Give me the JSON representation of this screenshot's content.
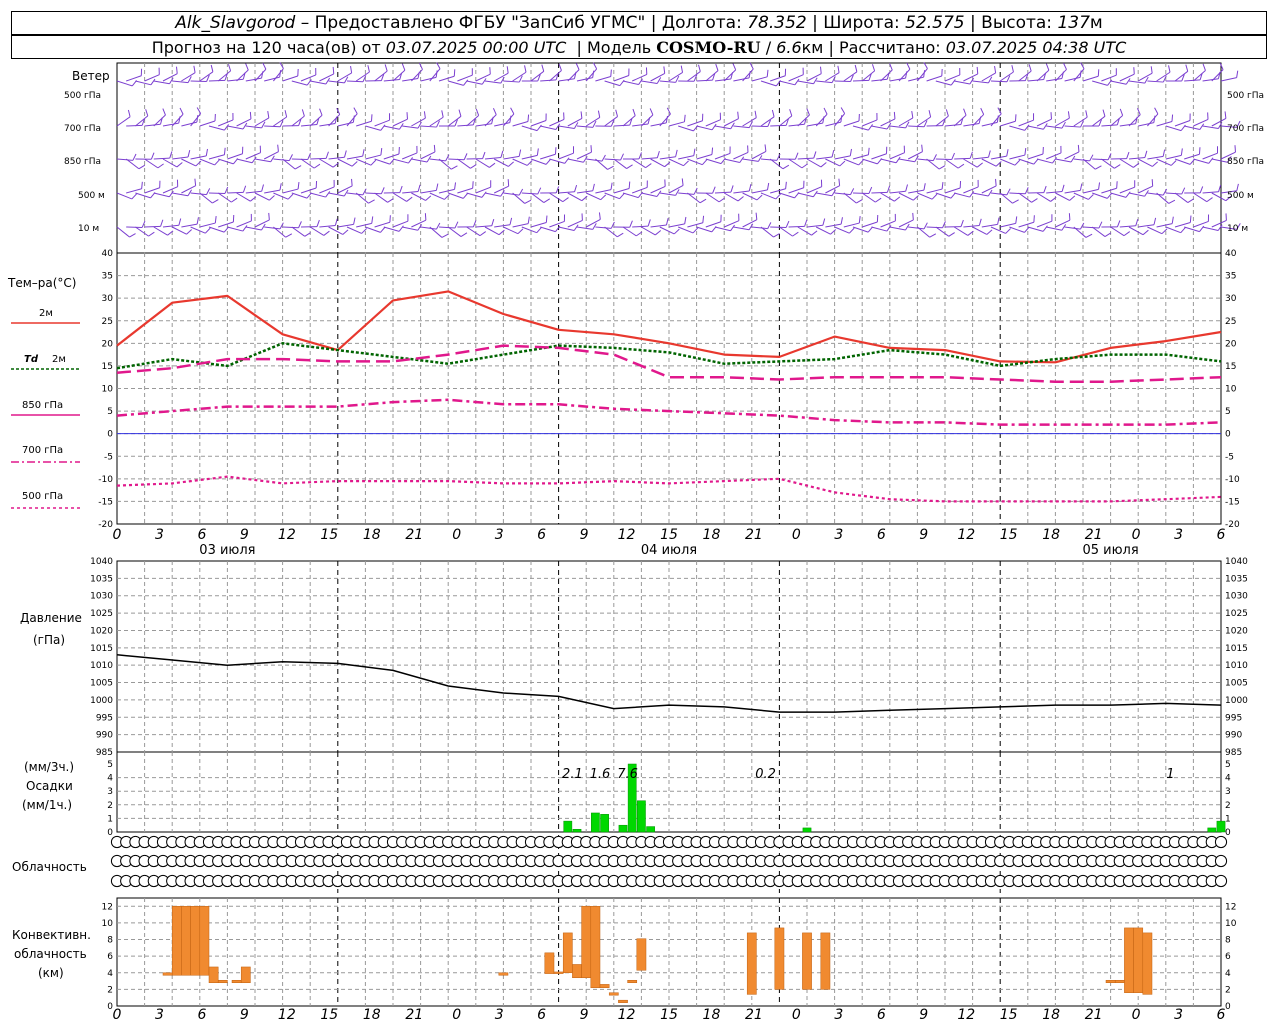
{
  "header": {
    "station": "Alk_Slavgorod",
    "dash": "–",
    "provider": "Предоставлено ФГБУ \"ЗапСиб УГМС\"",
    "sep": "|",
    "lon_label": "Долгота:",
    "lon": "78.352",
    "lat_label": "Широта:",
    "lat": "52.575",
    "alt_label": "Высота:",
    "alt": "137",
    "alt_unit": "м",
    "forecast_label": "Прогноз на 120 часа(ов)",
    "from_label": "от",
    "start": "03.07.2025 00:00 UTC",
    "model_label": "Модель",
    "model": "COSMO-RU",
    "slash": "/",
    "res": "6.6",
    "res_unit": "км",
    "calc_label": "Рассчитано:",
    "calc": "03.07.2025 04:38 UTC"
  },
  "labels": {
    "wind": "Ветер",
    "w500": "500 гПа",
    "w700": "700 гПа",
    "w850": "850 гПа",
    "w500m": "500 м",
    "w10m": "10 м",
    "temp": "Тем–ра(°C)",
    "t2m": "2м",
    "td": "Td",
    "td2m": "2м",
    "t850": "850 гПа",
    "t700": "700 гПа",
    "t500": "500 гПа",
    "pres1": "Давление",
    "pres2": "(гПа)",
    "prec1": "(мм/3ч.)",
    "prec2": "Осадки",
    "prec3": "(мм/1ч.)",
    "cloud": "Облачность",
    "conv1": "Конвективн.",
    "conv2": "облачность",
    "conv3": "(км)"
  },
  "dates": [
    "03 июля",
    "04 июля",
    "05 июля"
  ],
  "x_ticks": [
    "0",
    "3",
    "6",
    "9",
    "12",
    "15",
    "18",
    "21",
    "0",
    "3",
    "6",
    "9",
    "12",
    "15",
    "18",
    "21",
    "0",
    "3",
    "6",
    "9",
    "12",
    "15",
    "18",
    "21",
    "0",
    "3",
    "6"
  ],
  "colors": {
    "t2m": "#e8382e",
    "td": "#006400",
    "t850": "#e0188c",
    "t700": "#e0188c",
    "t500": "#e0188c",
    "zero": "#3030e0",
    "wind": "#7b3fd0",
    "pres": "#000000",
    "prec": "#00d800",
    "conv": "#f08a30"
  },
  "chart_data": [
    {
      "type": "line",
      "title": "Тем–ра(°C)",
      "x_hours": [
        0,
        6,
        12,
        18,
        24,
        30,
        36,
        42,
        48,
        54,
        60,
        66,
        72,
        78,
        84,
        90,
        96,
        102,
        108,
        114,
        120
      ],
      "ylim": [
        -20,
        40
      ],
      "yticks": [
        "-20",
        "-15",
        "-10",
        "-5",
        "0",
        "5",
        "10",
        "15",
        "20",
        "25",
        "30",
        "35",
        "40"
      ],
      "series": [
        {
          "name": "2м",
          "values": [
            19.5,
            29,
            30.5,
            22,
            18.5,
            29.5,
            31.5,
            26.5,
            23,
            22,
            20,
            17.5,
            17,
            21.5,
            19,
            18.5,
            16,
            15.8,
            19,
            20.5,
            22.5
          ]
        },
        {
          "name": "Td 2м",
          "values": [
            14.5,
            16.5,
            15,
            20,
            18.5,
            17,
            15.5,
            17.5,
            19.5,
            19,
            18,
            15.5,
            16,
            16.5,
            18.5,
            17.5,
            15,
            16.5,
            17.5,
            17.5,
            16
          ]
        },
        {
          "name": "850 гПа",
          "values": [
            13.5,
            14.5,
            16.5,
            16.5,
            16,
            16,
            17.5,
            19.5,
            19,
            17.5,
            12.5,
            12.5,
            12,
            12.5,
            12.5,
            12.5,
            12,
            11.5,
            11.5,
            12,
            12.5
          ]
        },
        {
          "name": "700 гПа",
          "values": [
            4,
            5,
            6,
            6,
            6,
            7,
            7.5,
            6.5,
            6.5,
            5.5,
            5,
            4.5,
            4,
            3,
            2.5,
            2.5,
            2,
            2,
            2,
            2,
            2.5
          ]
        },
        {
          "name": "500 гПа",
          "values": [
            -11.5,
            -11,
            -9.5,
            -11,
            -10.5,
            -10.5,
            -10.5,
            -11,
            -11,
            -10.5,
            -11,
            -10.5,
            -10,
            -13,
            -14.5,
            -15,
            -15,
            -15,
            -15,
            -14.5,
            -14
          ]
        }
      ]
    },
    {
      "type": "line",
      "title": "Давление",
      "ylabel": "(гПа)",
      "x_hours": [
        0,
        6,
        12,
        18,
        24,
        30,
        36,
        42,
        48,
        54,
        60,
        66,
        72,
        78,
        84,
        90,
        96,
        102,
        108,
        114,
        120
      ],
      "ylim": [
        985,
        1040
      ],
      "yticks": [
        "985",
        "990",
        "995",
        "1000",
        "1005",
        "1010",
        "1015",
        "1020",
        "1025",
        "1030",
        "1035",
        "1040"
      ],
      "series": [
        {
          "name": "Давление",
          "values": [
            1013,
            1011.5,
            1010,
            1011,
            1010.5,
            1008.5,
            1004,
            1002,
            1001,
            997.5,
            998.5,
            998,
            996.5,
            996.5,
            997,
            997.5,
            998,
            998.5,
            998.5,
            999,
            998.5
          ]
        }
      ]
    },
    {
      "type": "bar",
      "title": "Осадки",
      "ylim": [
        0,
        5
      ],
      "yticks": [
        "0",
        "1",
        "2",
        "3",
        "4",
        "5"
      ],
      "hours": [
        48,
        49,
        50,
        51,
        52,
        53,
        54,
        55,
        56,
        57,
        58,
        59,
        60,
        61,
        62,
        63,
        64,
        65,
        66,
        67,
        68,
        69,
        70,
        71,
        72,
        73,
        74,
        75,
        76,
        77,
        78,
        79,
        80,
        81,
        82,
        83,
        84,
        85,
        86,
        87,
        88,
        89,
        90,
        91,
        92,
        93,
        94,
        95,
        96,
        97,
        98,
        99,
        100,
        101,
        102,
        103,
        104,
        105,
        106,
        107,
        108,
        109,
        110,
        111,
        112,
        113,
        114,
        115,
        116,
        117,
        118,
        119,
        120
      ],
      "values": [
        0,
        0.8,
        0.2,
        0,
        1.4,
        1.3,
        0,
        0.5,
        5,
        2.3,
        0.4,
        0,
        0,
        0,
        0,
        0,
        0,
        0,
        0,
        0,
        0,
        0,
        0,
        0,
        0,
        0,
        0,
        0.3,
        0,
        0,
        0,
        0,
        0,
        0,
        0,
        0,
        0,
        0,
        0,
        0,
        0,
        0,
        0,
        0,
        0,
        0,
        0,
        0,
        0,
        0,
        0,
        0,
        0,
        0,
        0,
        0,
        0,
        0,
        0,
        0,
        0,
        0,
        0,
        0,
        0,
        0,
        0,
        0,
        0,
        0,
        0,
        0.3,
        0.8
      ],
      "labels": [
        {
          "hour": 49.5,
          "text": "2.1"
        },
        {
          "hour": 52.5,
          "text": "1.6"
        },
        {
          "hour": 55.5,
          "text": "7.6"
        },
        {
          "hour": 70.5,
          "text": "0.2"
        },
        {
          "hour": 114.5,
          "text": "1"
        }
      ]
    },
    {
      "type": "bar",
      "title": "Конвективн. облачность",
      "ylabel": "(км)",
      "ylim": [
        0,
        13
      ],
      "yticks": [
        "0",
        "2",
        "4",
        "6",
        "8",
        "10",
        "12"
      ],
      "bars": [
        {
          "h": 5.5,
          "lo": 3.7,
          "hi": 4.0
        },
        {
          "h": 6.5,
          "lo": 3.7,
          "hi": 12.0
        },
        {
          "h": 7.5,
          "lo": 3.7,
          "hi": 12.0
        },
        {
          "h": 8.5,
          "lo": 3.7,
          "hi": 12.0
        },
        {
          "h": 9.5,
          "lo": 3.7,
          "hi": 12.0
        },
        {
          "h": 10.5,
          "lo": 2.8,
          "hi": 4.7
        },
        {
          "h": 11.5,
          "lo": 2.8,
          "hi": 3.1
        },
        {
          "h": 13.0,
          "lo": 2.8,
          "hi": 3.1
        },
        {
          "h": 14.0,
          "lo": 2.8,
          "hi": 4.7
        },
        {
          "h": 42.0,
          "lo": 3.7,
          "hi": 4.0
        },
        {
          "h": 47.0,
          "lo": 3.9,
          "hi": 6.4
        },
        {
          "h": 48.0,
          "lo": 3.9,
          "hi": 4.1
        },
        {
          "h": 49.0,
          "lo": 4.0,
          "hi": 8.8
        },
        {
          "h": 50.0,
          "lo": 3.4,
          "hi": 5.0
        },
        {
          "h": 51.0,
          "lo": 3.4,
          "hi": 12.0
        },
        {
          "h": 52.0,
          "lo": 2.2,
          "hi": 12.0
        },
        {
          "h": 53.0,
          "lo": 2.2,
          "hi": 2.6
        },
        {
          "h": 54.0,
          "lo": 1.3,
          "hi": 1.6
        },
        {
          "h": 55.0,
          "lo": 0.4,
          "hi": 0.7
        },
        {
          "h": 56.0,
          "lo": 2.8,
          "hi": 3.1
        },
        {
          "h": 57.0,
          "lo": 4.3,
          "hi": 8.1
        },
        {
          "h": 69.0,
          "lo": 1.4,
          "hi": 8.8
        },
        {
          "h": 72.0,
          "lo": 2.0,
          "hi": 9.4
        },
        {
          "h": 75.0,
          "lo": 2.0,
          "hi": 8.8
        },
        {
          "h": 77.0,
          "lo": 2.0,
          "hi": 8.8
        },
        {
          "h": 108.0,
          "lo": 2.8,
          "hi": 3.1
        },
        {
          "h": 109.0,
          "lo": 2.8,
          "hi": 3.1
        },
        {
          "h": 110.0,
          "lo": 1.6,
          "hi": 9.4
        },
        {
          "h": 111.0,
          "lo": 1.6,
          "hi": 9.4
        },
        {
          "h": 112.0,
          "lo": 1.4,
          "hi": 8.8
        }
      ]
    }
  ],
  "cloud_rows": [
    "0000000000000000000000000000000000000000000000000000000000000000000000000000000000000000000000000000000000000000000000000",
    "0000000000000000000000000000000000000000000000000000000000000000000000000000000000000000000000000000000000000000000000000",
    "0000000000000000000000000000000000000000000000000000000000000000000000000000000000000000000000000000000000000000000000000"
  ]
}
